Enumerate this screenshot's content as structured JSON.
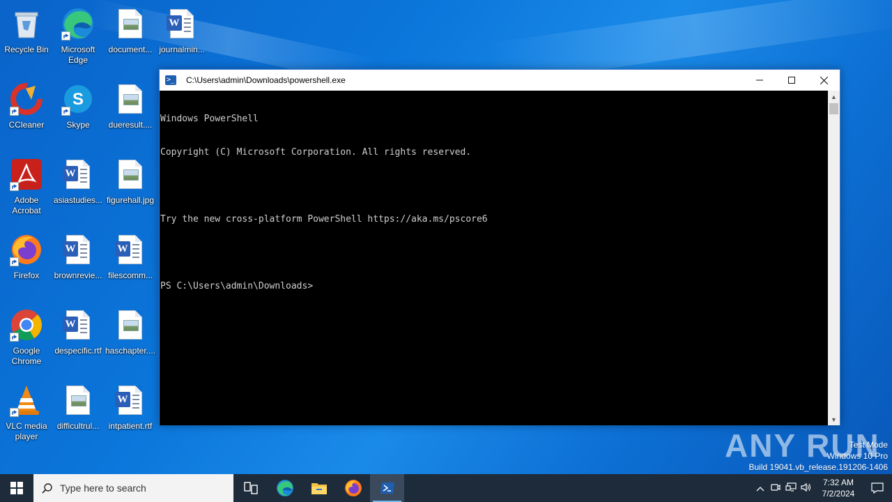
{
  "desktop": {
    "icons": [
      {
        "label": "Recycle Bin"
      },
      {
        "label": "Microsoft Edge"
      },
      {
        "label": "document..."
      },
      {
        "label": "journalmin..."
      },
      {
        "label": "CCleaner"
      },
      {
        "label": "Skype"
      },
      {
        "label": "dueresult...."
      },
      {
        "label": "Adobe Acrobat"
      },
      {
        "label": "asiastudies..."
      },
      {
        "label": "figurehall.jpg"
      },
      {
        "label": "Firefox"
      },
      {
        "label": "brownrevie..."
      },
      {
        "label": "filescomm..."
      },
      {
        "label": "Google Chrome"
      },
      {
        "label": "despecific.rtf"
      },
      {
        "label": "haschapter...."
      },
      {
        "label": "VLC media player"
      },
      {
        "label": "difficultrul..."
      },
      {
        "label": "intpatient.rtf"
      }
    ]
  },
  "window": {
    "title": "C:\\Users\\admin\\Downloads\\powershell.exe",
    "console_lines": [
      "Windows PowerShell",
      "Copyright (C) Microsoft Corporation. All rights reserved.",
      "",
      "Try the new cross-platform PowerShell https://aka.ms/pscore6",
      "",
      "PS C:\\Users\\admin\\Downloads>"
    ]
  },
  "watermark": {
    "logo": "ANY RUN",
    "line1": "Test Mode",
    "line2": "Windows 10 Pro",
    "line3": "Build 19041.vb_release.191206-1406"
  },
  "taskbar": {
    "search_placeholder": "Type here to search",
    "time": "7:32 AM",
    "date": "7/2/2024"
  },
  "colors": {
    "accent": "#0b76db",
    "taskbar": "#1d2b3a",
    "console_bg": "#000000",
    "console_fg": "#cfcfcf"
  }
}
